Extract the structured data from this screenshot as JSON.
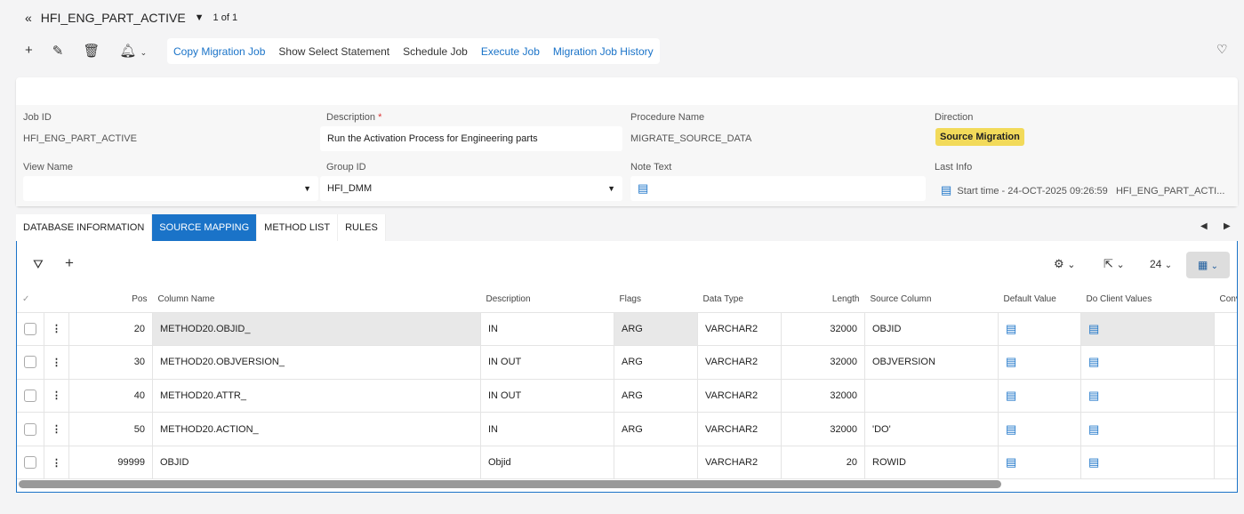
{
  "header": {
    "title": "HFI_ENG_PART_ACTIVE",
    "pager": "1 of 1"
  },
  "commands": [
    {
      "label": "Copy Migration Job",
      "link": true
    },
    {
      "label": "Show Select Statement",
      "link": false
    },
    {
      "label": "Schedule Job",
      "link": false
    },
    {
      "label": "Execute Job",
      "link": true
    },
    {
      "label": "Migration Job History",
      "link": true
    }
  ],
  "form": {
    "job_id_label": "Job ID",
    "job_id": "HFI_ENG_PART_ACTIVE",
    "description_label": "Description",
    "required": "*",
    "description": "Run the Activation Process for Engineering parts",
    "procedure_label": "Procedure Name",
    "procedure": "MIGRATE_SOURCE_DATA",
    "direction_label": "Direction",
    "direction": "Source Migration",
    "view_label": "View Name",
    "view": "",
    "group_label": "Group ID",
    "group": "HFI_DMM",
    "note_label": "Note Text",
    "note": "",
    "last_info_label": "Last Info",
    "last_info": "Start time - 24-OCT-2025 09:26:59   HFI_ENG_PART_ACTI..."
  },
  "tabs": [
    "DATABASE INFORMATION",
    "SOURCE MAPPING",
    "METHOD LIST",
    "RULES"
  ],
  "table": {
    "page_size": "24",
    "columns": [
      "Pos",
      "Column Name",
      "Description",
      "Flags",
      "Data Type",
      "Length",
      "Source Column",
      "Default Value",
      "Do Client Values",
      "Conv"
    ],
    "rows": [
      {
        "pos": "20",
        "name": "METHOD20.OBJID_",
        "desc": "IN",
        "flags": "ARG",
        "type": "VARCHAR2",
        "len": "32000",
        "src": "OBJID"
      },
      {
        "pos": "30",
        "name": "METHOD20.OBJVERSION_",
        "desc": "IN OUT",
        "flags": "ARG",
        "type": "VARCHAR2",
        "len": "32000",
        "src": "OBJVERSION"
      },
      {
        "pos": "40",
        "name": "METHOD20.ATTR_",
        "desc": "IN OUT",
        "flags": "ARG",
        "type": "VARCHAR2",
        "len": "32000",
        "src": ""
      },
      {
        "pos": "50",
        "name": "METHOD20.ACTION_",
        "desc": "IN",
        "flags": "ARG",
        "type": "VARCHAR2",
        "len": "32000",
        "src": "'DO'"
      },
      {
        "pos": "99999",
        "name": "OBJID",
        "desc": "Objid",
        "flags": "",
        "type": "VARCHAR2",
        "len": "20",
        "src": "ROWID"
      }
    ]
  }
}
